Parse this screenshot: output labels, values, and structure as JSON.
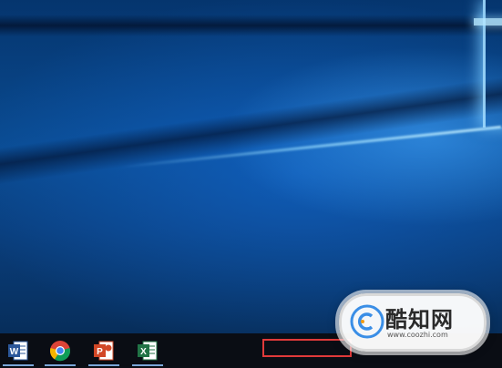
{
  "taskbar": {
    "apps": [
      {
        "name": "word-icon",
        "glyph": "W"
      },
      {
        "name": "chrome-icon",
        "glyph": ""
      },
      {
        "name": "powerpoint-icon",
        "glyph": "P"
      },
      {
        "name": "excel-icon",
        "glyph": "X"
      }
    ]
  },
  "watermark": {
    "text": "酷知网",
    "url": "www.coozhi.com"
  },
  "colors": {
    "highlight": "#e03a3a",
    "taskbar": "#0a0d14"
  }
}
